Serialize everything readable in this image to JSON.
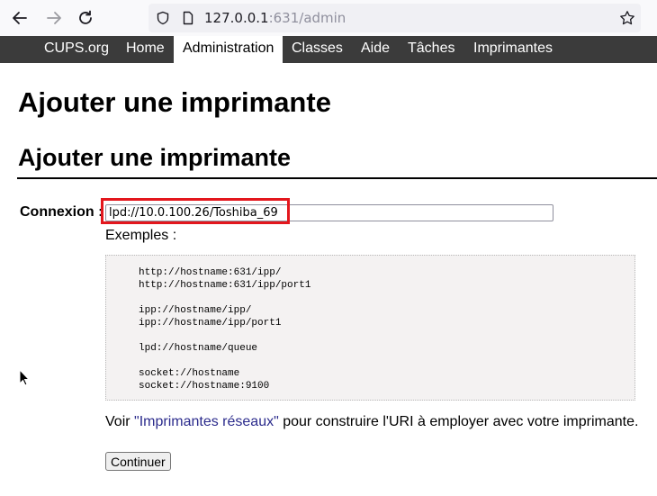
{
  "browser": {
    "url_host": "127.0.0.1",
    "url_port_path": ":631/admin",
    "icons": [
      "back-icon",
      "forward-icon",
      "reload-icon",
      "shield-icon",
      "page-icon",
      "star-icon"
    ]
  },
  "nav": {
    "items": [
      {
        "label": "CUPS.org",
        "active": false
      },
      {
        "label": "Home",
        "active": false
      },
      {
        "label": "Administration",
        "active": true
      },
      {
        "label": "Classes",
        "active": false
      },
      {
        "label": "Aide",
        "active": false
      },
      {
        "label": "Tâches",
        "active": false
      },
      {
        "label": "Imprimantes",
        "active": false
      }
    ]
  },
  "page": {
    "title": "Ajouter une imprimante",
    "subtitle": "Ajouter une imprimante"
  },
  "form": {
    "connection_label": "Connexion :",
    "connection_value": "lpd://10.0.100.26/Toshiba_69",
    "examples_label": "Exemples :",
    "examples": [
      "http://hostname:631/ipp/",
      "http://hostname:631/ipp/port1",
      "",
      "ipp://hostname/ipp/",
      "ipp://hostname/ipp/port1",
      "",
      "lpd://hostname/queue",
      "",
      "socket://hostname",
      "socket://hostname:9100"
    ],
    "voir_prefix": "Voir ",
    "voir_link": "\"Imprimantes réseaux\"",
    "voir_suffix": " pour construire l'URI à employer avec votre imprimante.",
    "continue_label": "Continuer"
  },
  "colors": {
    "nav_bg": "#3b3b3b",
    "highlight": "#e3171d",
    "link": "#2b2b8c"
  }
}
